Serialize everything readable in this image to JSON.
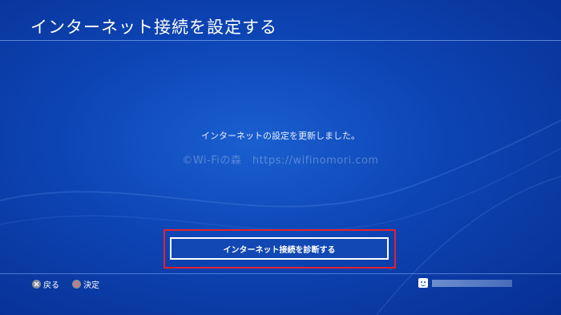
{
  "header": {
    "title": "インターネット接続を設定する"
  },
  "main": {
    "message": "インターネットの設定を更新しました。",
    "watermark": "©Wi-Fiの森　https://wifinomori.com",
    "action_button": {
      "label": "インターネット接続を診断する"
    }
  },
  "footer": {
    "back": {
      "icon": "cross-button-icon",
      "label": "戻る"
    },
    "confirm": {
      "icon": "circle-button-icon",
      "label": "決定"
    },
    "user": {
      "icon": "user-avatar-icon"
    }
  },
  "colors": {
    "background": "#0d44b4",
    "highlight": "#e8202a",
    "button": "#1248b4",
    "text": "#ffffff"
  }
}
